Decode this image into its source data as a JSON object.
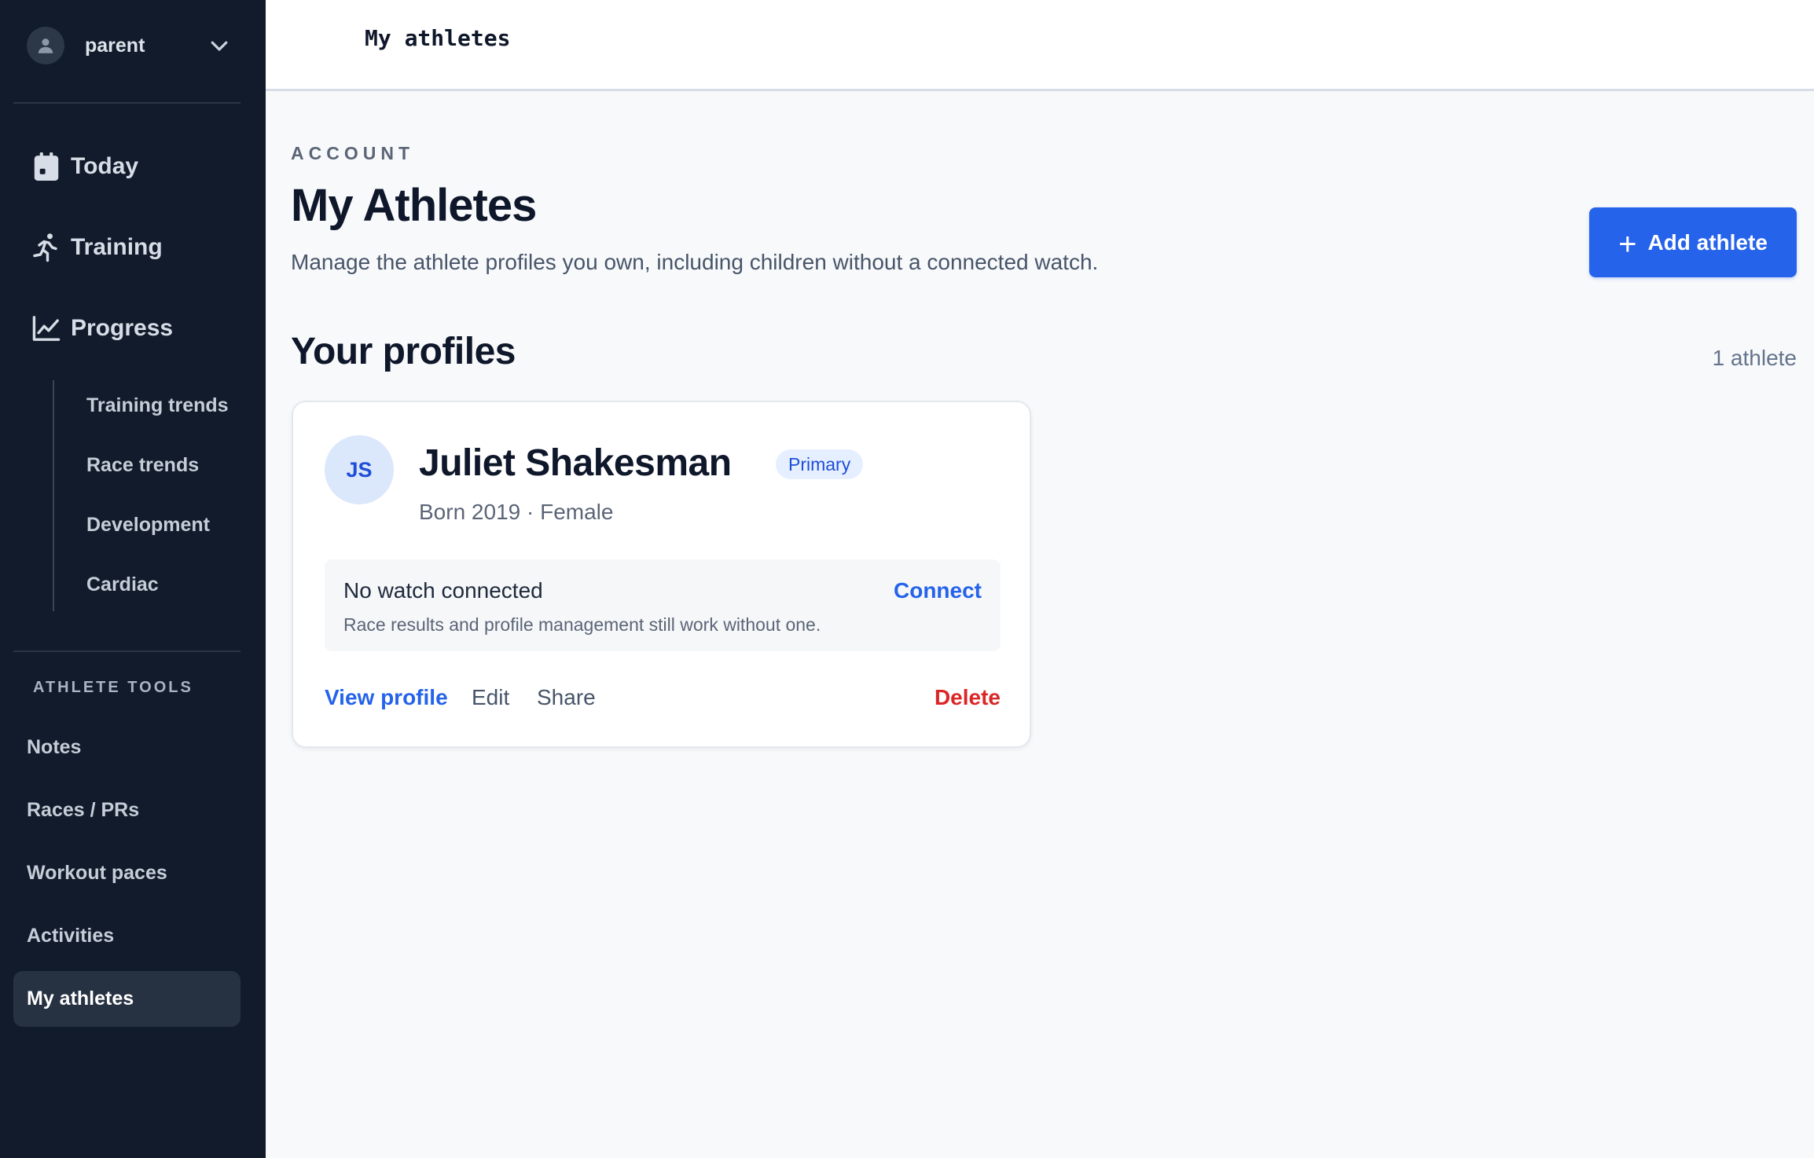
{
  "user": {
    "name": "parent",
    "avatar_icon": "user-icon",
    "chevron_icon": "chevron-down-icon"
  },
  "nav": {
    "main": [
      {
        "label": "Today",
        "icon": "calendar-icon"
      },
      {
        "label": "Training",
        "icon": "runner-icon"
      },
      {
        "label": "Progress",
        "icon": "line-chart-icon"
      }
    ],
    "progress_sub": [
      "Training trends",
      "Race trends",
      "Development",
      "Cardiac"
    ],
    "tools_heading": "ATHLETE TOOLS",
    "tools": [
      "Notes",
      "Races / PRs",
      "Workout paces",
      "Activities"
    ],
    "tools_active": "My athletes"
  },
  "topbar": {
    "title": "My athletes"
  },
  "header": {
    "eyebrow": "ACCOUNT",
    "title": "My Athletes",
    "description": "Manage the athlete profiles you own, including children without a connected watch.",
    "add_button": "Add athlete"
  },
  "profiles": {
    "title": "Your profiles",
    "count": "1 athlete",
    "items": [
      {
        "initials": "JS",
        "name": "Juliet Shakesman",
        "badge": "Primary",
        "meta": "Born 2019 · Female",
        "watch_title": "No watch connected",
        "watch_sub": "Race results and profile management still work without one.",
        "connect": "Connect",
        "actions": {
          "view": "View profile",
          "edit": "Edit",
          "share": "Share",
          "delete": "Delete"
        }
      }
    ]
  },
  "colors": {
    "sidebar_bg": "#121b2b",
    "accent": "#2563eb",
    "danger": "#dc2626"
  }
}
